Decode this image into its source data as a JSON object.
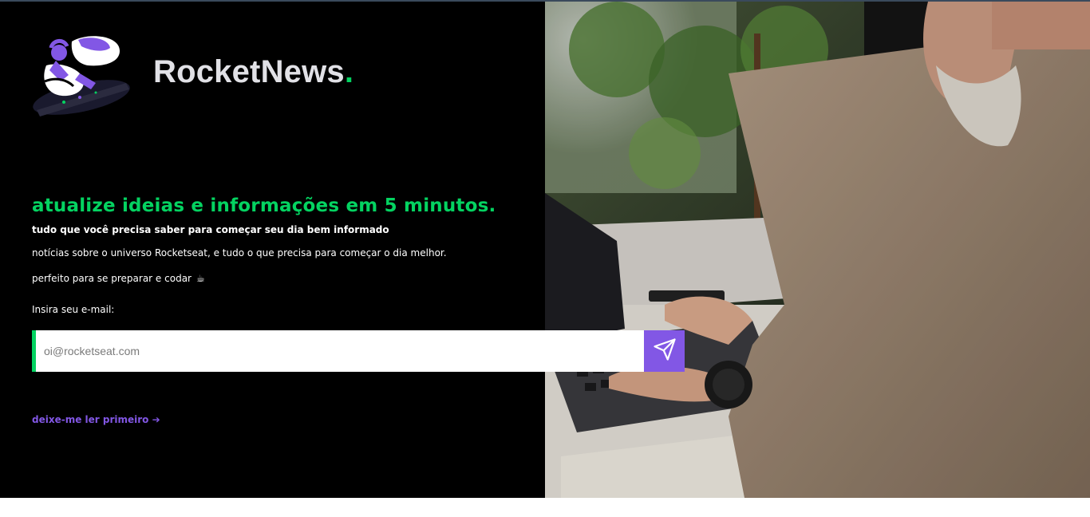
{
  "brand": {
    "name": "RocketNews",
    "dot": "."
  },
  "hero": {
    "headline": "atualize ideias e informações em 5 minutos.",
    "subheadline": "tudo que você precisa saber para começar seu dia bem informado",
    "description": "notícias sobre o universo Rocketseat, e tudo o que precisa para começar o dia melhor.",
    "tagline": "perfeito para se preparar e codar",
    "tagline_icon": "☕",
    "email_label": "Insira seu e-mail:",
    "email_placeholder": "oi@rocketseat.com",
    "email_value": "",
    "submit_icon": "send-icon",
    "read_first_link": "deixe-me ler primeiro ➔"
  },
  "colors": {
    "background": "#000000",
    "accent_green": "#04d361",
    "accent_purple": "#8257e5",
    "brand_text": "#e1e1e6"
  }
}
